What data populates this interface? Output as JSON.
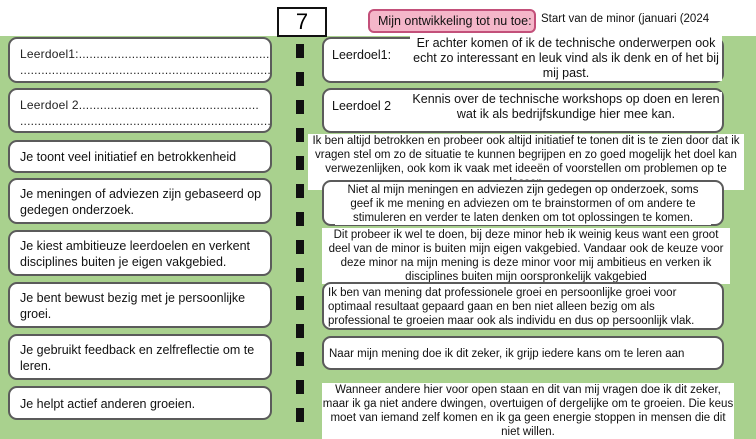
{
  "header": {
    "number": "7",
    "title": "Mijn ontwikkeling tot nu toe:",
    "start": "Start van de minor (januari (2024"
  },
  "criteria": [
    {
      "label": "Leerdoel1:.......................................................",
      "dots": "..........................................................................."
    },
    {
      "label": "Leerdoel 2...................................................",
      "dots": "..........................................................................."
    },
    {
      "label": "Je toont veel initiatief en betrokkenheid"
    },
    {
      "label": "Je meningen of adviezen zijn gebaseerd op gedegen onderzoek."
    },
    {
      "label": "Je kiest ambitieuze leerdoelen en verkent disciplines buiten je eigen vakgebied."
    },
    {
      "label": "Je bent bewust bezig met je persoonlijke groei."
    },
    {
      "label": "Je gebruikt feedback en zelfreflectie om te leren."
    },
    {
      "label": "Je helpt actief anderen groeien."
    }
  ],
  "responses": [
    {
      "label": "Leerdoel1:",
      "text": "Er achter komen of ik de technische onderwerpen ook echt zo interessant en leuk vind als ik denk en of het bij mij past."
    },
    {
      "label": "Leerdoel 2",
      "text": "Kennis over de technische workshops op doen en leren wat ik als bedrijfskundige hier mee kan."
    },
    {
      "text": "Ik ben altijd betrokken en probeer ook altijd initiatief te tonen dit is te zien door dat ik vragen stel om zo de situatie te kunnen begrijpen en zo goed mogelijk het doel kan verwezenlijken, ook kom ik vaak met ideeën of voorstellen om problemen op te lossen"
    },
    {
      "text": "Niet al mijn meningen en adviezen zijn gedegen op onderzoek, soms geef ik me mening en adviezen om te brainstormen of om andere te stimuleren en verder te laten denken om tot oplossingen te komen."
    },
    {
      "text": "Dit probeer ik wel te doen, bij deze minor heb ik weinig keus want een groot deel van de minor is buiten mijn eigen vakgebied. Vandaar ook de keuze voor deze minor na mijn mening is deze minor voor mij ambitieus en verken ik disciplines buiten mijn oorspronkelijk vakgebied"
    },
    {
      "text": "Ik ben van mening dat professionele groei en persoonlijke groei voor optimaal resultaat gepaard gaan en ben niet alleen bezig om als professional te groeien maar ook als individu en dus op persoonlijk vlak."
    },
    {
      "text": "Naar mijn mening doe ik dit zeker, ik grijp iedere kans om te leren aan"
    },
    {
      "text": "Wanneer andere hier voor open staan en dit van mij vragen doe ik dit zeker, maar ik ga niet andere dwingen, overtuigen of dergelijke om te groeien. Die keus moet van iemand zelf komen en ik ga geen energie stoppen in mensen die dit niet willen."
    }
  ]
}
